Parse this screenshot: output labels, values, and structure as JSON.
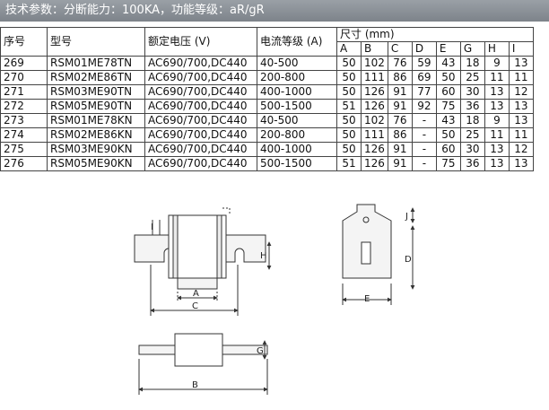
{
  "banner": {
    "title": "技术参数：分断能力：100KA，功能等级：aR/gR"
  },
  "table": {
    "headers": {
      "no": "序号",
      "model": "型号",
      "voltage": "额定电压 (V)",
      "current": "电流等级 (A)",
      "dims": "尺寸 (mm)"
    },
    "dim_cols": [
      "A",
      "B",
      "C",
      "D",
      "E",
      "G",
      "H",
      "I"
    ],
    "rows": [
      {
        "no": "269",
        "model": "RSM01ME78TN",
        "voltage": "AC690/700,DC440",
        "current": "40-500",
        "dims": [
          "50",
          "102",
          "76",
          "59",
          "43",
          "18",
          "9",
          "13"
        ]
      },
      {
        "no": "270",
        "model": "RSM02ME86TN",
        "voltage": "AC690/700,DC440",
        "current": "200-800",
        "dims": [
          "50",
          "111",
          "86",
          "69",
          "50",
          "25",
          "11",
          "11"
        ]
      },
      {
        "no": "271",
        "model": "RSM03ME90TN",
        "voltage": "AC690/700,DC440",
        "current": "400-1000",
        "dims": [
          "50",
          "126",
          "91",
          "77",
          "60",
          "30",
          "13",
          "12"
        ]
      },
      {
        "no": "272",
        "model": "RSM05ME90TN",
        "voltage": "AC690/700,DC440",
        "current": "500-1500",
        "dims": [
          "51",
          "126",
          "91",
          "92",
          "75",
          "36",
          "13",
          "13"
        ]
      },
      {
        "no": "273",
        "model": "RSM01ME78KN",
        "voltage": "AC690/700,DC440",
        "current": "40-500",
        "dims": [
          "50",
          "102",
          "76",
          "-",
          "43",
          "18",
          "9",
          "13"
        ]
      },
      {
        "no": "274",
        "model": "RSM02ME86KN",
        "voltage": "AC690/700,DC440",
        "current": "200-800",
        "dims": [
          "50",
          "111",
          "86",
          "-",
          "50",
          "25",
          "11",
          "11"
        ]
      },
      {
        "no": "275",
        "model": "RSM03ME90KN",
        "voltage": "AC690/700,DC440",
        "current": "400-1000",
        "dims": [
          "50",
          "126",
          "91",
          "-",
          "60",
          "30",
          "13",
          "12"
        ]
      },
      {
        "no": "276",
        "model": "RSM05ME90KN",
        "voltage": "AC690/700,DC440",
        "current": "500-1500",
        "dims": [
          "51",
          "126",
          "91",
          "-",
          "75",
          "36",
          "13",
          "13"
        ]
      }
    ]
  },
  "diagram_labels": {
    "i": "I",
    "h": "H",
    "a": "A",
    "c": "C",
    "j": "J",
    "d": "D",
    "e": "E",
    "g": "G",
    "b": "B"
  }
}
